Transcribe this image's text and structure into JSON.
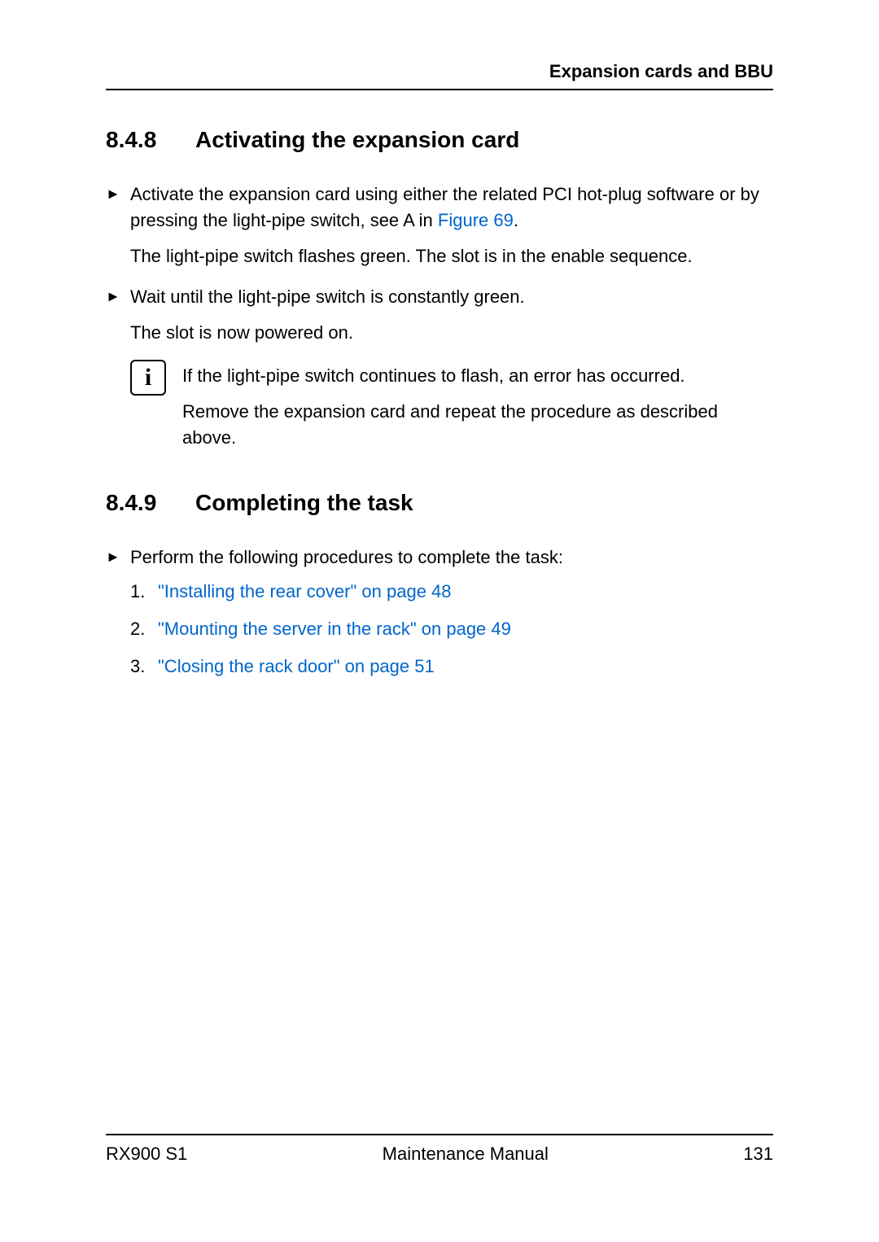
{
  "header": {
    "title": "Expansion cards and BBU"
  },
  "sections": {
    "s1": {
      "number": "8.4.8",
      "title": "Activating the expansion card",
      "bullet1_pre": "Activate the expansion card using either the related PCI hot-plug software or by pressing the light-pipe switch, see A in ",
      "bullet1_link": "Figure 69",
      "bullet1_post": ".",
      "para1": "The light-pipe switch flashes green. The slot is in the enable sequence.",
      "bullet2": "Wait until the light-pipe switch is constantly green.",
      "para2": "The slot is now powered on.",
      "note_p1": "If the light-pipe switch continues to flash, an error has occurred.",
      "note_p2": "Remove the expansion card and repeat the procedure as described above."
    },
    "s2": {
      "number": "8.4.9",
      "title": "Completing the task",
      "bullet1": "Perform the following procedures to complete the task:",
      "links": {
        "l1": "\"Installing the rear cover\" on page 48",
        "l2": "\"Mounting the server in the rack\" on page 49",
        "l3": "\"Closing the rack door\" on page 51"
      }
    }
  },
  "footer": {
    "left": "RX900 S1",
    "center": "Maintenance Manual",
    "right": "131"
  },
  "labels": {
    "ol1": "1.",
    "ol2": "2.",
    "ol3": "3."
  },
  "info_glyph": "i"
}
